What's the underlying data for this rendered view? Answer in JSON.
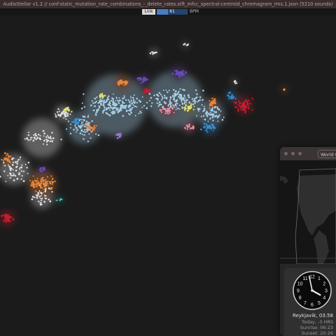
{
  "app": {
    "title": "AudioStellar v1.2 // conf-static_mutation_rate_combinations_-_delete_rates.stft_mfcc_spectral-centroid_chromagram_rms.1.json (5210 sounds)"
  },
  "toolbar": {
    "link_label": "Link",
    "bpm_value": "81",
    "bpm_label": "BPM"
  },
  "world_clock": {
    "window_title": "World Clock",
    "city_time": "Reykjavik, 03:58",
    "day_offset": "Today, -3 HRS",
    "sunrise": "Sunrise: 06:23",
    "sunset": "Sunset: 20:26",
    "clock_time": {
      "hours": 3,
      "minutes": 58
    },
    "clock_numerals": [
      "12",
      "1",
      "2",
      "3",
      "4",
      "5",
      "6",
      "7",
      "8",
      "9",
      "10",
      "11"
    ]
  },
  "colors": {
    "background": "#1b1b1b",
    "titlebar": "#3a2c2c",
    "bpm_slider": "#4a7cc0",
    "cluster_palette": [
      "#a8d0e8",
      "#e8883a",
      "#6a4ab8",
      "#c81e2e",
      "#e0e07a",
      "#3a8cc8",
      "#e88aa0",
      "#9a7ad8",
      "#e0e0e0",
      "#3ab8b8"
    ]
  }
}
